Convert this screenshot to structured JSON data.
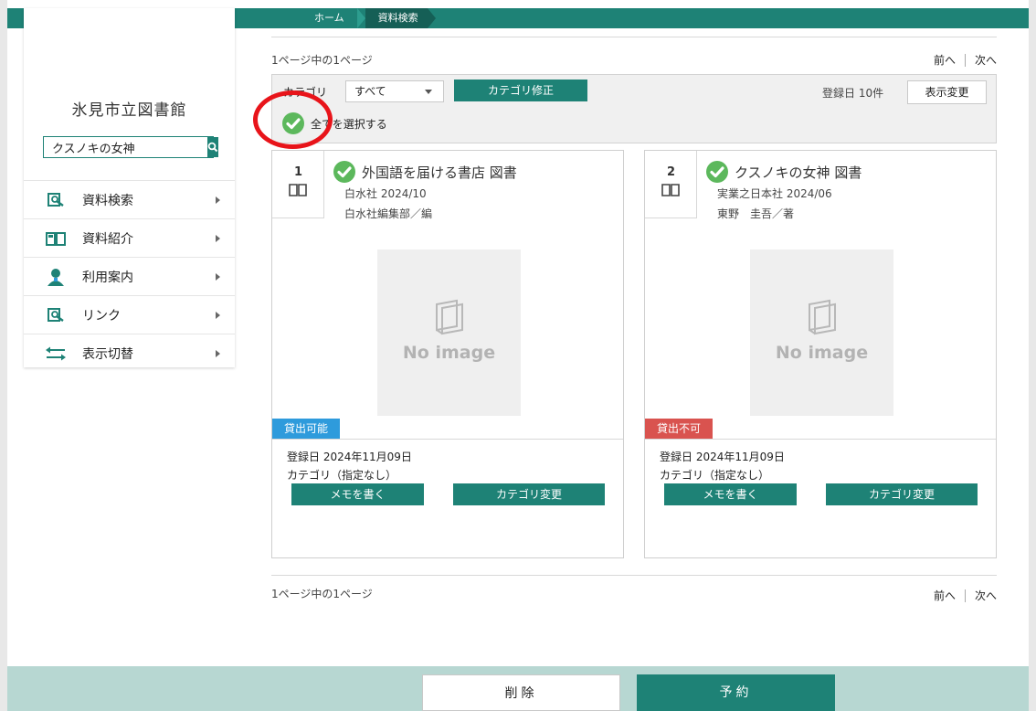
{
  "breadcrumb": {
    "home": "ホーム",
    "current": "資料検索"
  },
  "sidebar": {
    "library_name": "氷見市立図書館",
    "search": {
      "value": "クスノキの女神",
      "placeholder": ""
    },
    "items": [
      {
        "label": "資料検索",
        "icon": "book-search-icon"
      },
      {
        "label": "資料紹介",
        "icon": "open-book-icon"
      },
      {
        "label": "利用案内",
        "icon": "person-icon"
      },
      {
        "label": "リンク",
        "icon": "link-search-icon"
      },
      {
        "label": "表示切替",
        "icon": "swap-arrows-icon"
      }
    ]
  },
  "pagination": {
    "info": "1ページ中の1ページ",
    "prev": "前へ",
    "next": "次へ"
  },
  "toolbar": {
    "category_label": "カテゴリ",
    "category_value": "すべて",
    "category_fix": "カテゴリ修正",
    "sort_info": "登録日 10件",
    "view_change": "表示変更",
    "select_all": "全てを選択する"
  },
  "results": [
    {
      "num": "1",
      "title": "外国語を届ける書店 図書",
      "publisher": "白水社 2024/10",
      "author": "白水社編集部／編",
      "noimage": "No image",
      "status": "貸出可能",
      "registered": "登録日 2024年11月09日",
      "category": "カテゴリ（指定なし）",
      "memo": "メモを書く",
      "category_change": "カテゴリ変更"
    },
    {
      "num": "2",
      "title": "クスノキの女神 図書",
      "publisher": "実業之日本社 2024/06",
      "author": "東野　圭吾／著",
      "noimage": "No image",
      "status": "貸出不可",
      "registered": "登録日 2024年11月09日",
      "category": "カテゴリ（指定なし）",
      "memo": "メモを書く",
      "category_change": "カテゴリ変更"
    }
  ],
  "footer": {
    "delete": "削除",
    "reserve": "予約"
  },
  "colors": {
    "accent": "#1e8276",
    "available": "#2e9bdc",
    "unavailable": "#d9534f",
    "check": "#5cb85c",
    "highlight": "#e8141a",
    "footer": "#b7d7d2"
  }
}
